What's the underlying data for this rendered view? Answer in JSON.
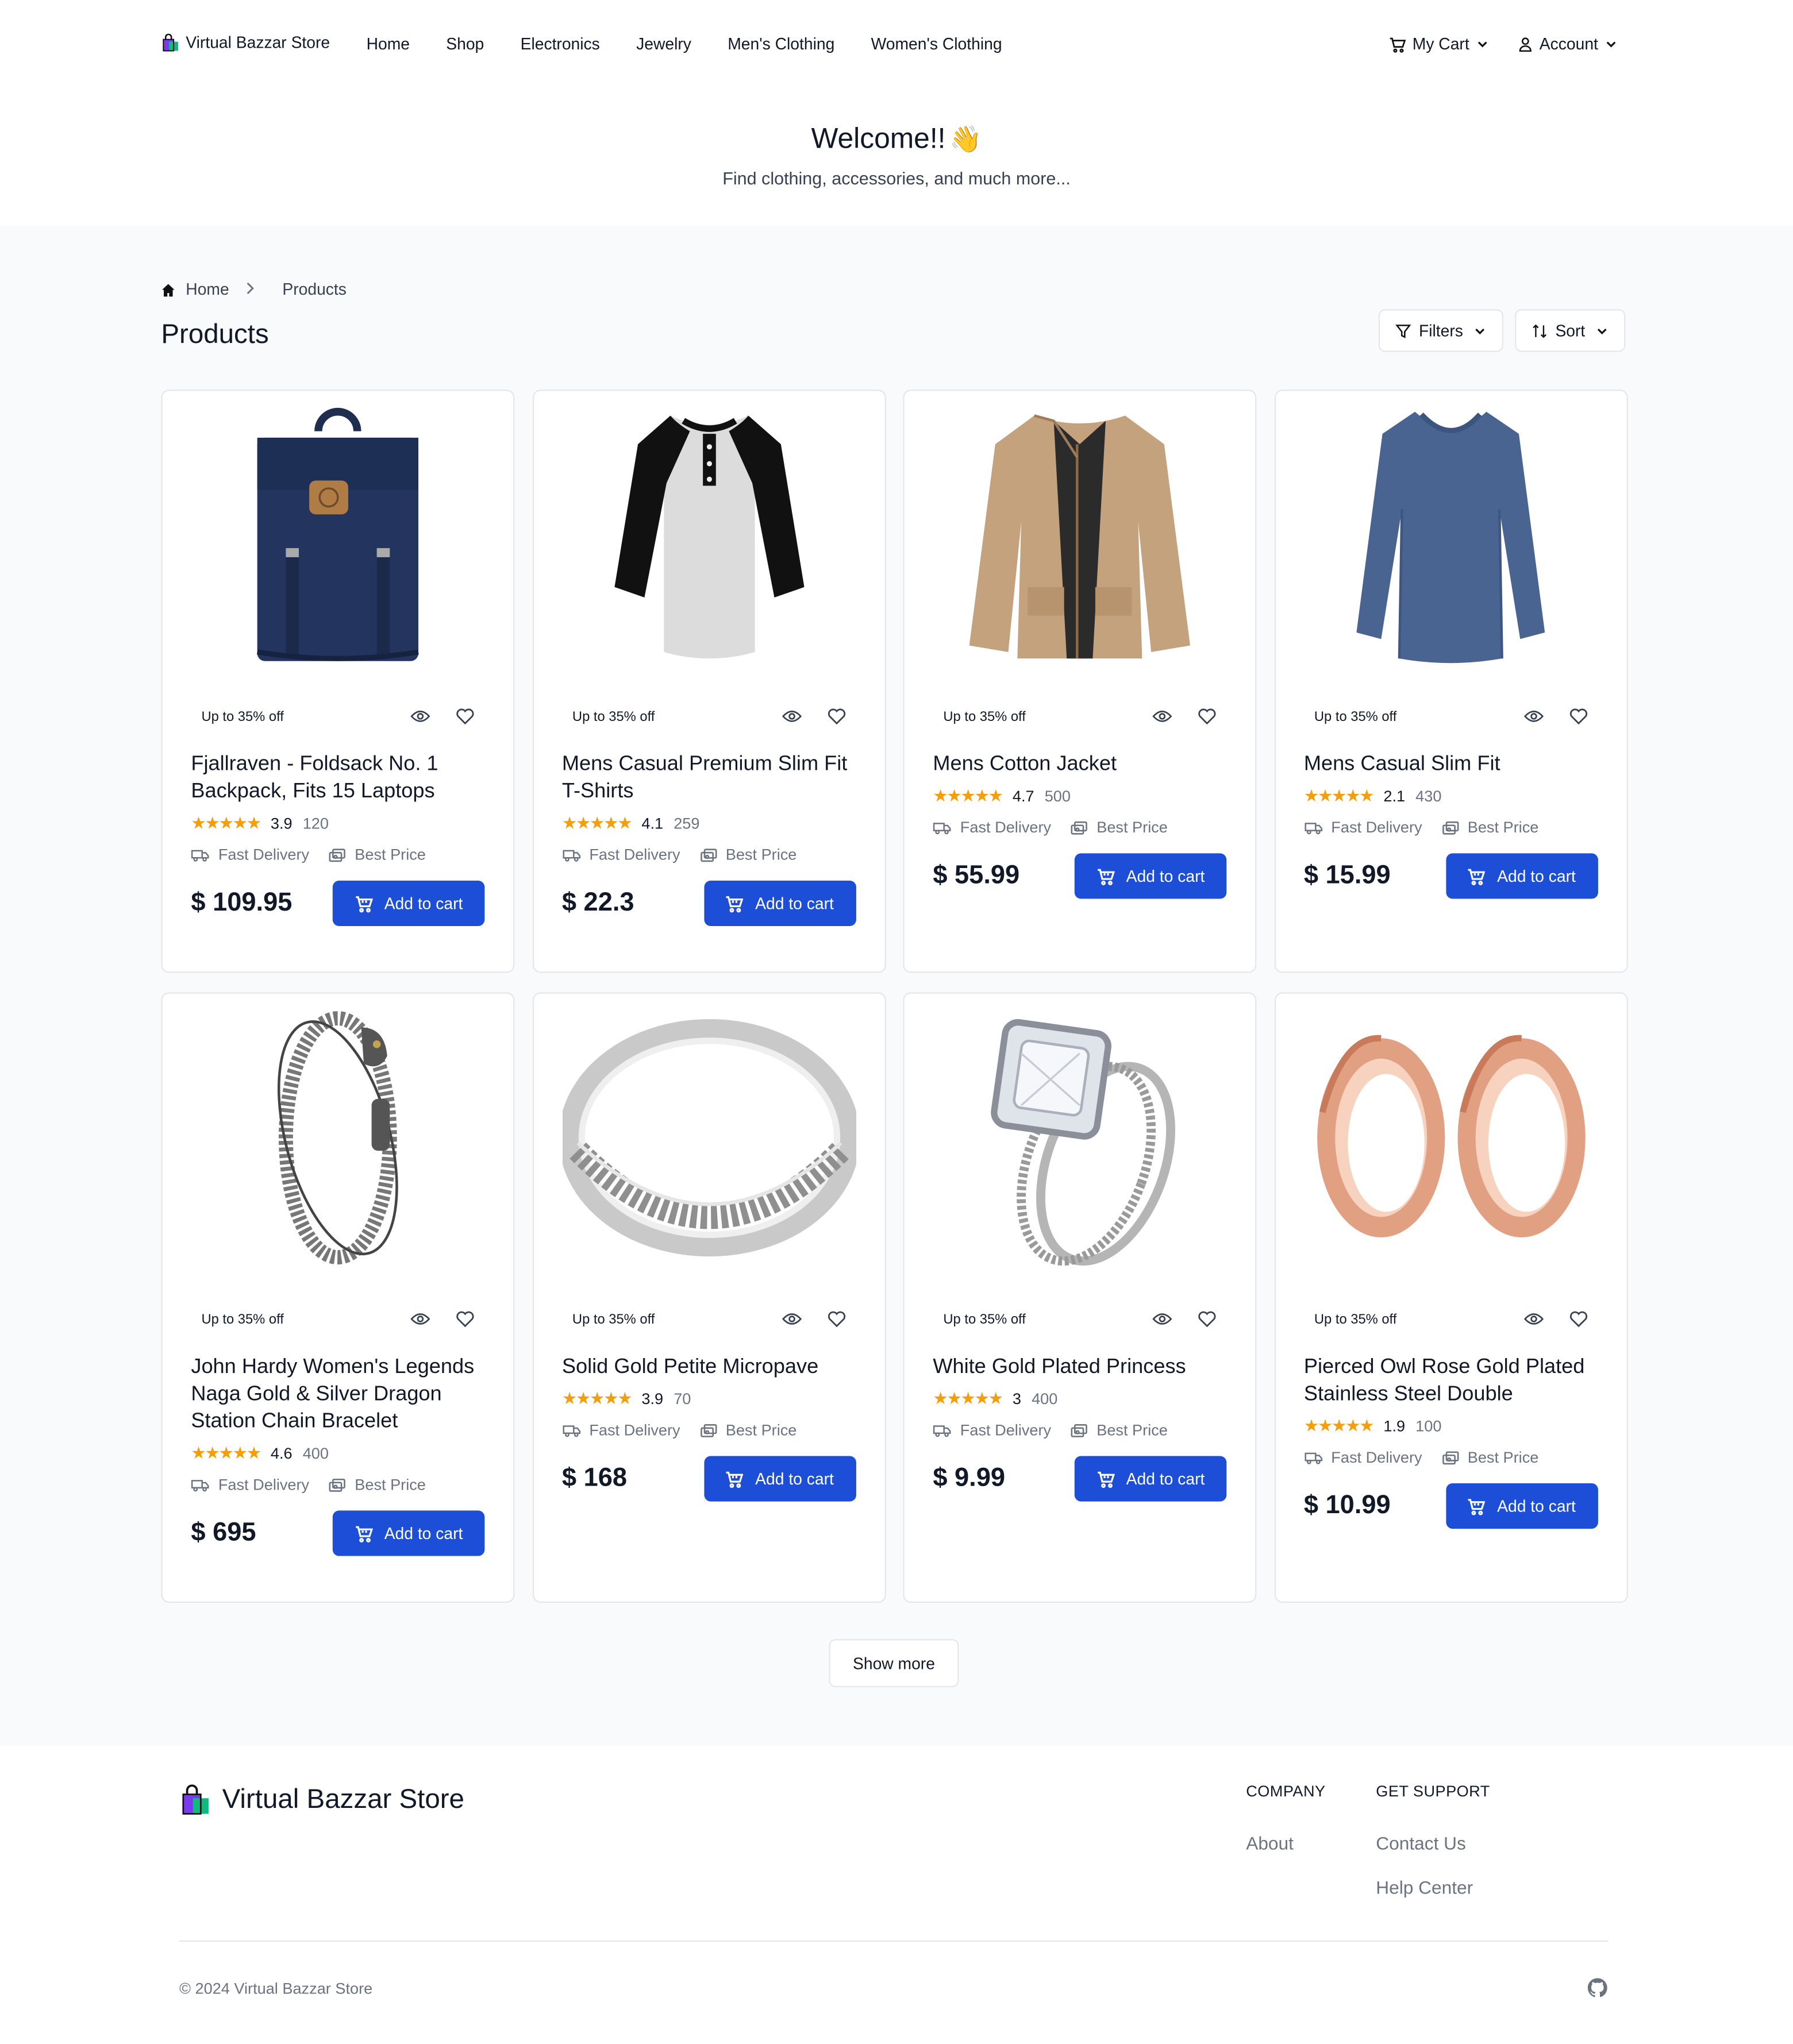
{
  "nav": {
    "brand": "Virtual Bazzar Store",
    "links": [
      "Home",
      "Shop",
      "Electronics",
      "Jewelry",
      "Men's Clothing",
      "Women's Clothing"
    ],
    "cart": "My Cart",
    "account": "Account"
  },
  "hero": {
    "title": "Welcome!!",
    "emoji": "👋",
    "subtitle": "Find clothing, accessories, and much more..."
  },
  "breadcrumb": {
    "home": "Home",
    "current": "Products"
  },
  "page": {
    "title": "Products",
    "filters": "Filters",
    "sort": "Sort"
  },
  "products": [
    {
      "badge": "Up to 35% off",
      "title": "Fjallraven - Foldsack No. 1 Backpack, Fits 15 Laptops",
      "stars": "★★★★★",
      "rating": "3.9",
      "count": "120",
      "perk1": "Fast Delivery",
      "perk2": "Best Price",
      "price": "$ 109.95",
      "cta": "Add to cart",
      "image": "backpack"
    },
    {
      "badge": "Up to 35% off",
      "title": "Mens Casual Premium Slim Fit T-Shirts",
      "stars": "★★★★★",
      "rating": "4.1",
      "count": "259",
      "perk1": "Fast Delivery",
      "perk2": "Best Price",
      "price": "$ 22.3",
      "cta": "Add to cart",
      "image": "raglan-tshirt"
    },
    {
      "badge": "Up to 35% off",
      "title": "Mens Cotton Jacket",
      "stars": "★★★★★",
      "rating": "4.7",
      "count": "500",
      "perk1": "Fast Delivery",
      "perk2": "Best Price",
      "price": "$ 55.99",
      "cta": "Add to cart",
      "image": "jacket"
    },
    {
      "badge": "Up to 35% off",
      "title": "Mens Casual Slim Fit",
      "stars": "★★★★★",
      "rating": "2.1",
      "count": "430",
      "perk1": "Fast Delivery",
      "perk2": "Best Price",
      "price": "$ 15.99",
      "cta": "Add to cart",
      "image": "long-sleeve"
    },
    {
      "badge": "Up to 35% off",
      "title": "John Hardy Women's Legends Naga Gold & Silver Dragon Station Chain Bracelet",
      "stars": "★★★★★",
      "rating": "4.6",
      "count": "400",
      "perk1": "Fast Delivery",
      "perk2": "Best Price",
      "price": "$ 695",
      "cta": "Add to cart",
      "image": "bracelet"
    },
    {
      "badge": "Up to 35% off",
      "title": "Solid Gold Petite Micropave",
      "stars": "★★★★★",
      "rating": "3.9",
      "count": "70",
      "perk1": "Fast Delivery",
      "perk2": "Best Price",
      "price": "$ 168",
      "cta": "Add to cart",
      "image": "band-ring"
    },
    {
      "badge": "Up to 35% off",
      "title": "White Gold Plated Princess",
      "stars": "★★★★★",
      "rating": "3",
      "count": "400",
      "perk1": "Fast Delivery",
      "perk2": "Best Price",
      "price": "$ 9.99",
      "cta": "Add to cart",
      "image": "princess-ring"
    },
    {
      "badge": "Up to 35% off",
      "title": "Pierced Owl Rose Gold Plated Stainless Steel Double",
      "stars": "★★★★★",
      "rating": "1.9",
      "count": "100",
      "perk1": "Fast Delivery",
      "perk2": "Best Price",
      "price": "$ 10.99",
      "cta": "Add to cart",
      "image": "rose-gold-plugs"
    }
  ],
  "show_more": "Show more",
  "footer": {
    "brand": "Virtual Bazzar Store",
    "company_heading": "COMPANY",
    "company_links": [
      "About"
    ],
    "support_heading": "GET SUPPORT",
    "support_links": [
      "Contact Us",
      "Help Center"
    ],
    "copyright": "© 2024 Virtual Bazzar Store"
  },
  "colors": {
    "primary": "#1d4ed8",
    "star": "#f59e0b",
    "muted": "#6b7280",
    "section_bg": "#f9fafb"
  }
}
